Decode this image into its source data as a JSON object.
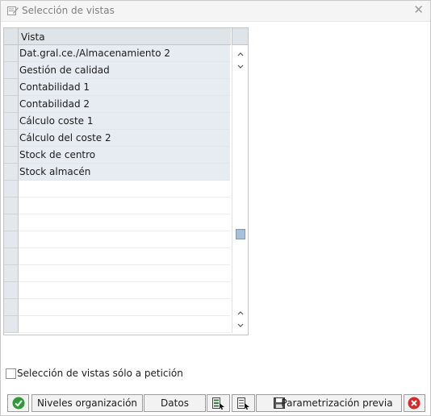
{
  "dialog": {
    "title": "Selección de vistas",
    "close_icon": "close-icon"
  },
  "table": {
    "column_header": "Vista",
    "rows": [
      "Dat.gral.ce./Almacenamiento 2",
      "Gestión de calidad",
      "Contabilidad 1",
      "Contabilidad 2",
      "Cálculo coste 1",
      "Cálculo del coste 2",
      "Stock de centro",
      "Stock almacén"
    ],
    "scroll_arrows": {
      "up": "^",
      "down": "v"
    }
  },
  "options": {
    "views_on_request_label": "Selección de vistas sólo a petición",
    "views_on_request_checked": false
  },
  "toolbar": {
    "confirm_icon": "check-icon",
    "org_levels_label": "Niveles organización",
    "data_label": "Datos",
    "select_all_icon": "select-all-icon",
    "deselect_all_icon": "deselect-all-icon",
    "save_icon": "save-icon",
    "default_values_label": "Parametrización previa",
    "cancel_icon": "cancel-icon"
  },
  "colors": {
    "confirm": "#2e9a36",
    "cancel": "#d42a2a",
    "selected_row": "#e6ecf2"
  }
}
